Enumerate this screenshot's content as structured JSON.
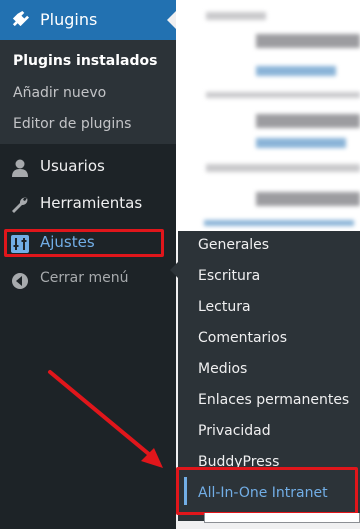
{
  "sidebar": {
    "plugins": {
      "label": "Plugins",
      "icon": "plugin-icon"
    },
    "plugins_sub": [
      {
        "label": "Plugins instalados",
        "active": true
      },
      {
        "label": "Añadir nuevo",
        "active": false
      },
      {
        "label": "Editor de plugins",
        "active": false
      }
    ],
    "usuarios": {
      "label": "Usuarios",
      "icon": "user-icon"
    },
    "herramientas": {
      "label": "Herramientas",
      "icon": "wrench-icon"
    },
    "ajustes": {
      "label": "Ajustes",
      "icon": "settings-icon"
    },
    "collapse": {
      "label": "Cerrar menú",
      "icon": "collapse-icon"
    }
  },
  "flyout": {
    "items": [
      {
        "label": "Generales"
      },
      {
        "label": "Escritura"
      },
      {
        "label": "Lectura"
      },
      {
        "label": "Comentarios"
      },
      {
        "label": "Medios"
      },
      {
        "label": "Enlaces permanentes"
      },
      {
        "label": "Privacidad"
      },
      {
        "label": "BuddyPress"
      },
      {
        "label": "All-In-One Intranet",
        "current": true
      }
    ]
  },
  "colors": {
    "sidebar_bg": "#1d2327",
    "submenu_bg": "#2c3338",
    "accent": "#2271b1",
    "link_blue": "#72aee6",
    "highlight_red": "#e0161b"
  }
}
